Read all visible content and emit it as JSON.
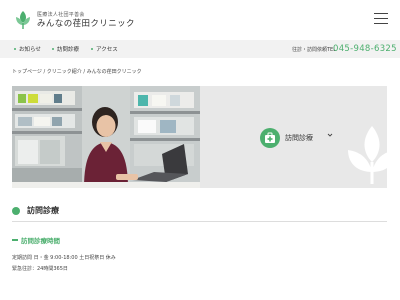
{
  "header": {
    "logo_sub": "医療法人社団平善会",
    "logo_main": "みんなの荏田クリニック",
    "menu_icon": "hamburger-icon"
  },
  "nav": {
    "items": [
      {
        "label": "お知らせ"
      },
      {
        "label": "訪問診療"
      },
      {
        "label": "アクセス"
      }
    ],
    "inquiry_label": "往診・訪問依頼TEL",
    "phone": "045-948-6325",
    "accent": "#4caf6e"
  },
  "breadcrumb": {
    "items": [
      "トップページ",
      "クリニック紹介",
      "みんなの荏田クリニック"
    ],
    "separator": " / "
  },
  "hero": {
    "menu_label": "訪問診療",
    "menu_icon": "medical-kit-icon",
    "chevron_icon": "chevron-down-icon"
  },
  "section": {
    "title": "訪問診療",
    "subtitle": "訪問診療時間",
    "lines": [
      "定期訪問 日・金 9:00-18:00 土日祝祭日 休み",
      "緊急往診：24時間365日"
    ]
  }
}
